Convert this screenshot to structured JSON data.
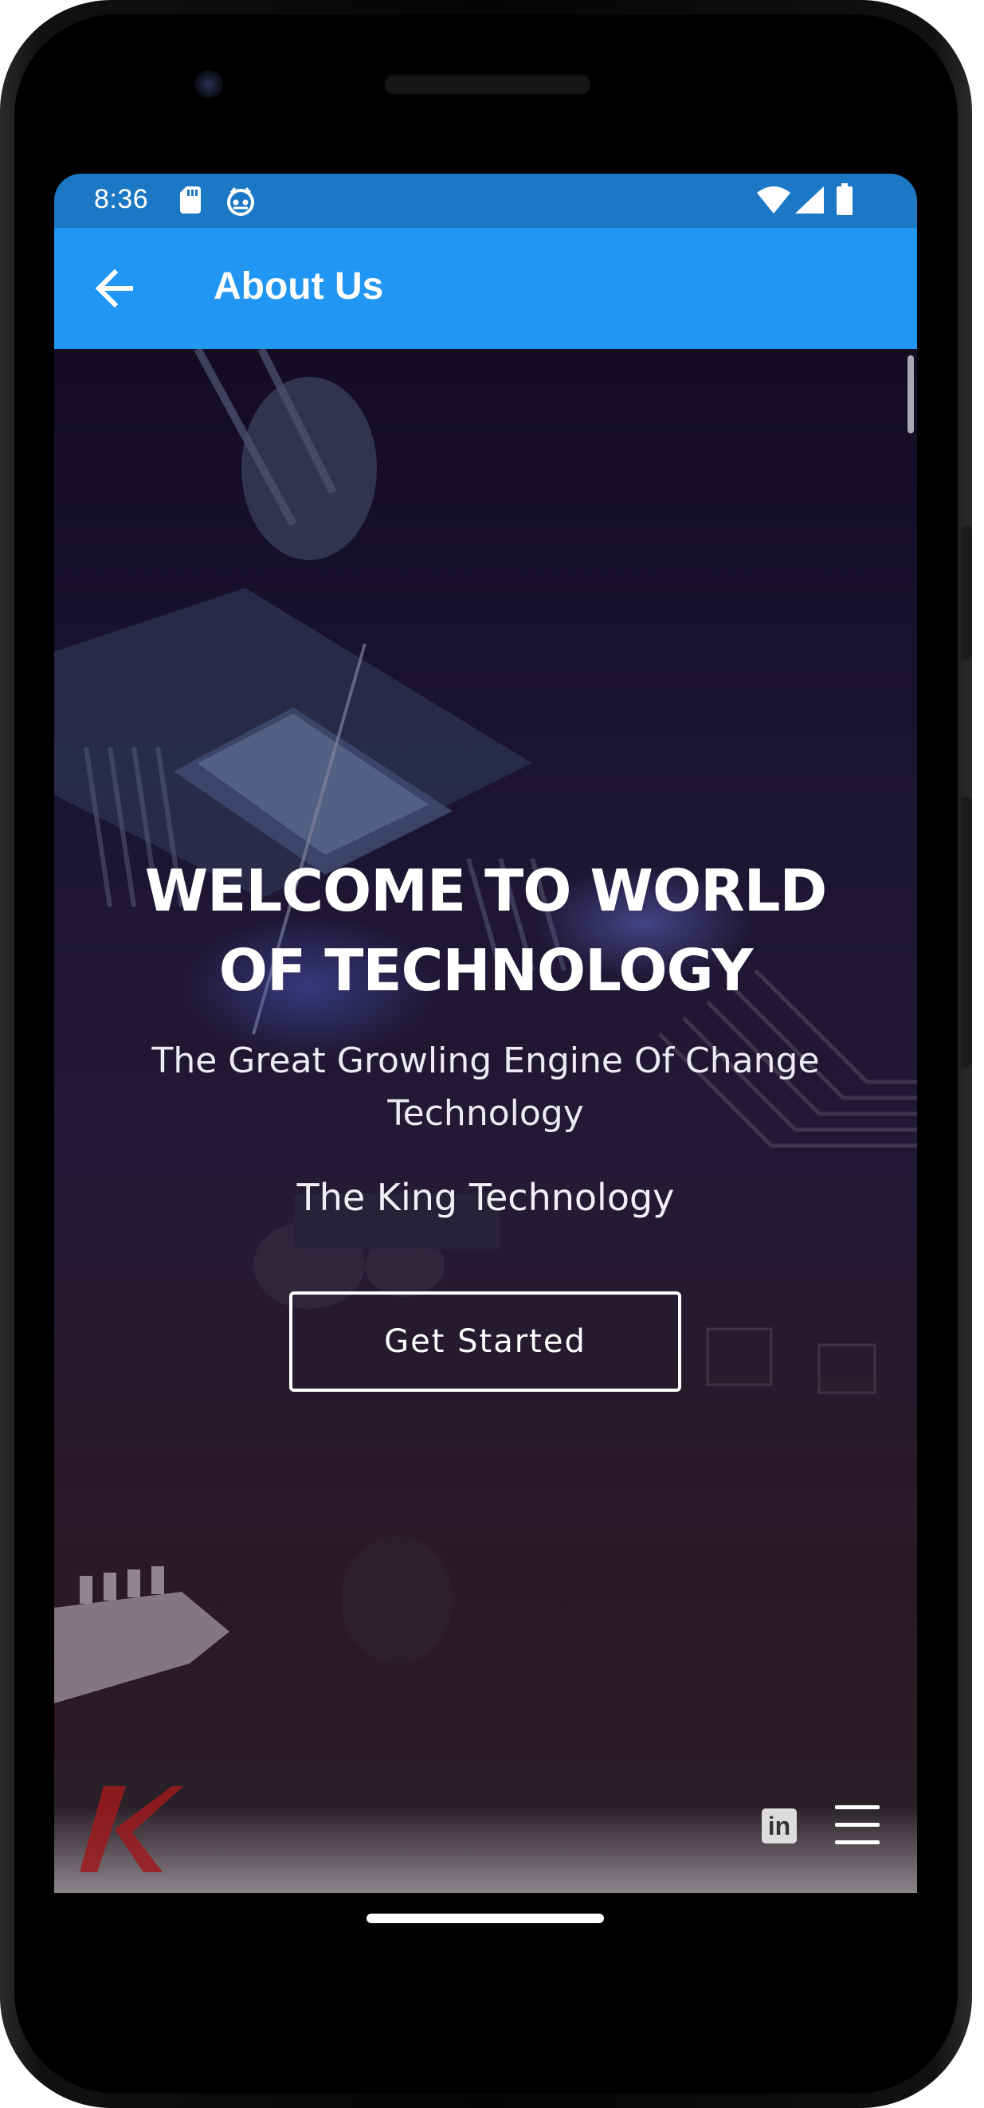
{
  "status_bar": {
    "time": "8:36",
    "left_icons": [
      "sd-card-icon",
      "robot-icon"
    ],
    "right_icons": [
      "wifi-icon",
      "cell-signal-icon",
      "battery-icon"
    ],
    "color": "#1c78c4"
  },
  "app_bar": {
    "title": "About Us",
    "back_icon": "arrow-left-icon",
    "color": "#2196f3"
  },
  "hero": {
    "title_line1": "WELCOME TO WORLD",
    "title_line2": "OF TECHNOLOGY",
    "subtitle_line1": "The Great Growling Engine Of Change",
    "subtitle_line2": "Technology",
    "tagline": "The King Technology",
    "cta_label": "Get Started"
  },
  "footer": {
    "logo_letter": "K",
    "logo_color": "#9c1a1f",
    "linkedin_label": "in",
    "menu_icon": "hamburger-menu-icon"
  }
}
